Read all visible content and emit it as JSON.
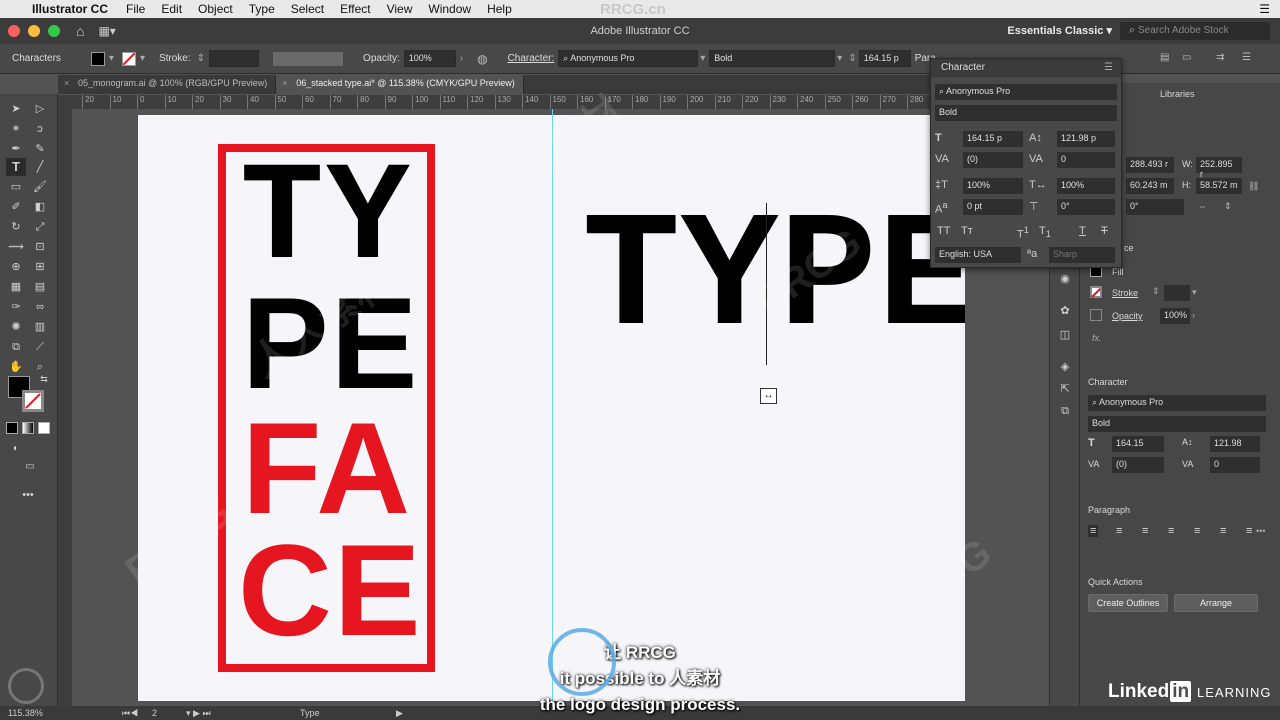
{
  "menubar": {
    "app_name": "Illustrator CC",
    "items": [
      "File",
      "Edit",
      "Object",
      "Type",
      "Select",
      "Effect",
      "View",
      "Window",
      "Help"
    ],
    "watermark": "RRCG.cn"
  },
  "titlebar": {
    "title": "Adobe Illustrator CC",
    "workspace": "Essentials Classic",
    "search_placeholder": "Search Adobe Stock"
  },
  "controlbar": {
    "mode_label": "Characters",
    "stroke_label": "Stroke:",
    "opacity_label": "Opacity:",
    "opacity_value": "100%",
    "character_label": "Character:",
    "font_family": "Anonymous Pro",
    "font_style": "Bold",
    "font_size": "164.15 p",
    "para_label": "Para"
  },
  "tabs": [
    {
      "label": "05_monogram.ai @ 100% (RGB/GPU Preview)"
    },
    {
      "label": "06_stacked type.ai* @ 115.38% (CMYK/GPU Preview)"
    }
  ],
  "ruler": {
    "ticks": [
      "20",
      "10",
      "0",
      "10",
      "20",
      "30",
      "40",
      "50",
      "60",
      "70",
      "80",
      "90",
      "100",
      "110",
      "120",
      "130",
      "140",
      "150",
      "160",
      "170",
      "180",
      "190",
      "200",
      "210",
      "220",
      "230",
      "240",
      "250",
      "260",
      "270",
      "280"
    ]
  },
  "artwork": {
    "line1": "TY",
    "line2": "PE",
    "line3": "FA",
    "line4": "CE",
    "horizontal": "TYPEFA",
    "accent": "#e5161f"
  },
  "character_panel": {
    "title": "Character",
    "font_family": "Anonymous Pro",
    "font_style": "Bold",
    "font_size": "164.15 p",
    "leading": "121.98 p",
    "kerning": "(0)",
    "tracking": "0",
    "vert_scale": "100%",
    "horiz_scale": "100%",
    "baseline": "0 pt",
    "rotation": "0°",
    "language": "English: USA",
    "aa": "Sharp"
  },
  "right_panel": {
    "tab_libraries": "Libraries",
    "x_value": "288.493 r",
    "w_label": "W:",
    "w_value": "252.895 r",
    "y_value": "60.243 m",
    "h_label": "H:",
    "h_value": "58.572 m",
    "angle": "0°",
    "appearance_partial": "ce",
    "fill_label": "Fill",
    "stroke_label": "Stroke",
    "opacity_label": "Opacity",
    "opacity_value": "100%",
    "fx": "fx.",
    "character_title": "Character",
    "font_family": "Anonymous Pro",
    "font_style": "Bold",
    "font_size": "164.15",
    "leading": "121.98",
    "kerning": "(0)",
    "tracking": "0",
    "paragraph_title": "Paragraph",
    "quick_actions_title": "Quick Actions",
    "create_outlines": "Create Outlines",
    "arrange": "Arrange"
  },
  "statusbar": {
    "zoom": "115.38%",
    "artboard": "2",
    "tool": "Type"
  },
  "subtitle": {
    "line1": "让  RRCG",
    "line2": "it possible to  人素材",
    "line3": "the logo design process."
  },
  "branding": {
    "linkedin": "Linked",
    "in": "in",
    "learning": "LEARNING"
  }
}
